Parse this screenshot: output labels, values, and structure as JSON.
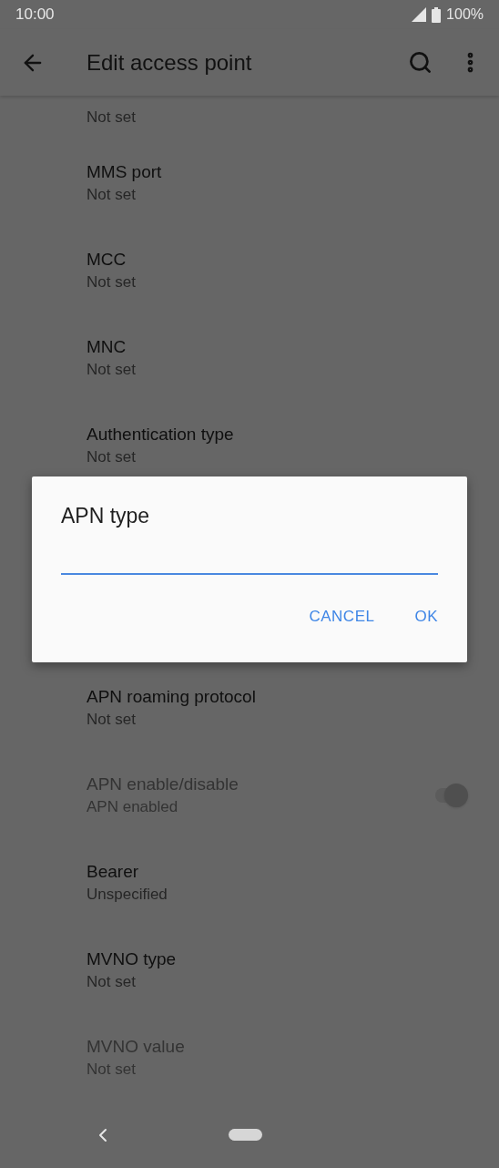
{
  "status_bar": {
    "time": "10:00",
    "battery": "100%"
  },
  "app_bar": {
    "title": "Edit access point"
  },
  "settings": [
    {
      "kind": "text",
      "summary": "Not set",
      "disabled": false
    },
    {
      "kind": "text",
      "title": "MMS port",
      "summary": "Not set",
      "disabled": false
    },
    {
      "kind": "text",
      "title": "MCC",
      "summary": "Not set",
      "disabled": false
    },
    {
      "kind": "text",
      "title": "MNC",
      "summary": "Not set",
      "disabled": false
    },
    {
      "kind": "text",
      "title": "Authentication type",
      "summary": "Not set",
      "disabled": false
    },
    {
      "kind": "hidden"
    },
    {
      "kind": "hidden"
    },
    {
      "kind": "text",
      "title": "APN roaming protocol",
      "summary": "Not set",
      "disabled": false
    },
    {
      "kind": "switch",
      "title": "APN enable/disable",
      "summary": "APN enabled",
      "disabled": true,
      "on": true
    },
    {
      "kind": "text",
      "title": "Bearer",
      "summary": "Unspecified",
      "disabled": false
    },
    {
      "kind": "text",
      "title": "MVNO type",
      "summary": "Not set",
      "disabled": false
    },
    {
      "kind": "text",
      "title": "MVNO value",
      "summary": "Not set",
      "disabled": true
    }
  ],
  "dialog": {
    "title": "APN type",
    "buttons": [
      "CANCEL",
      "OK"
    ]
  }
}
